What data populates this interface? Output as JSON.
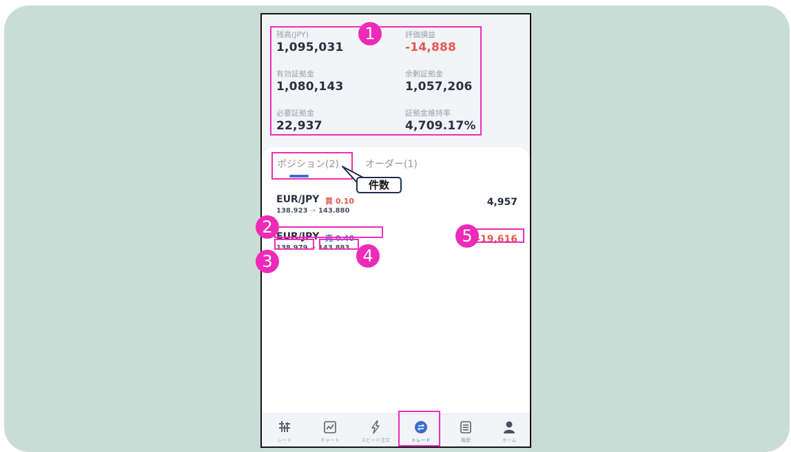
{
  "summary": {
    "balance": {
      "label": "残高(JPY)",
      "value": "1,095,031"
    },
    "unrealized_pl": {
      "label": "評価損益",
      "value": "-14,888"
    },
    "effective_margin": {
      "label": "有効証拠金",
      "value": "1,080,143"
    },
    "free_margin": {
      "label": "余剰証拠金",
      "value": "1,057,206"
    },
    "required_margin": {
      "label": "必要証拠金",
      "value": "22,937"
    },
    "margin_ratio": {
      "label": "証拠金維持率",
      "value": "4,709.17%"
    }
  },
  "tabs": [
    {
      "label": "ポジション(2)",
      "active": true
    },
    {
      "label": "オーダー(1)",
      "active": false
    }
  ],
  "positions": [
    {
      "pair": "EUR/JPY",
      "side": "買 0.10",
      "side_type": "buy",
      "open_price": "138.923",
      "arrow": "→",
      "current_price": "143.880",
      "pl": "4,957",
      "pl_negative": false
    },
    {
      "pair": "EUR/JPY",
      "side": "売 0.40",
      "side_type": "sell",
      "open_price": "138.979",
      "arrow": "→",
      "current_price": "143.883",
      "pl": "-19,616",
      "pl_negative": true
    }
  ],
  "nav": [
    {
      "label": "レート",
      "icon": "rate-icon"
    },
    {
      "label": "チャート",
      "icon": "chart-icon"
    },
    {
      "label": "スピード注文",
      "icon": "lightning-icon"
    },
    {
      "label": "トレード",
      "icon": "trade-icon",
      "active": true
    },
    {
      "label": "履歴",
      "icon": "history-icon"
    },
    {
      "label": "ホーム",
      "icon": "person-icon"
    }
  ],
  "annotations": {
    "badges": [
      "1",
      "2",
      "3",
      "4",
      "5"
    ],
    "callout": "件数"
  },
  "colors": {
    "accent": "#ee2bb8",
    "negative": "#e5584f",
    "sell": "#3b6fd1",
    "background": "#cadcd6"
  }
}
